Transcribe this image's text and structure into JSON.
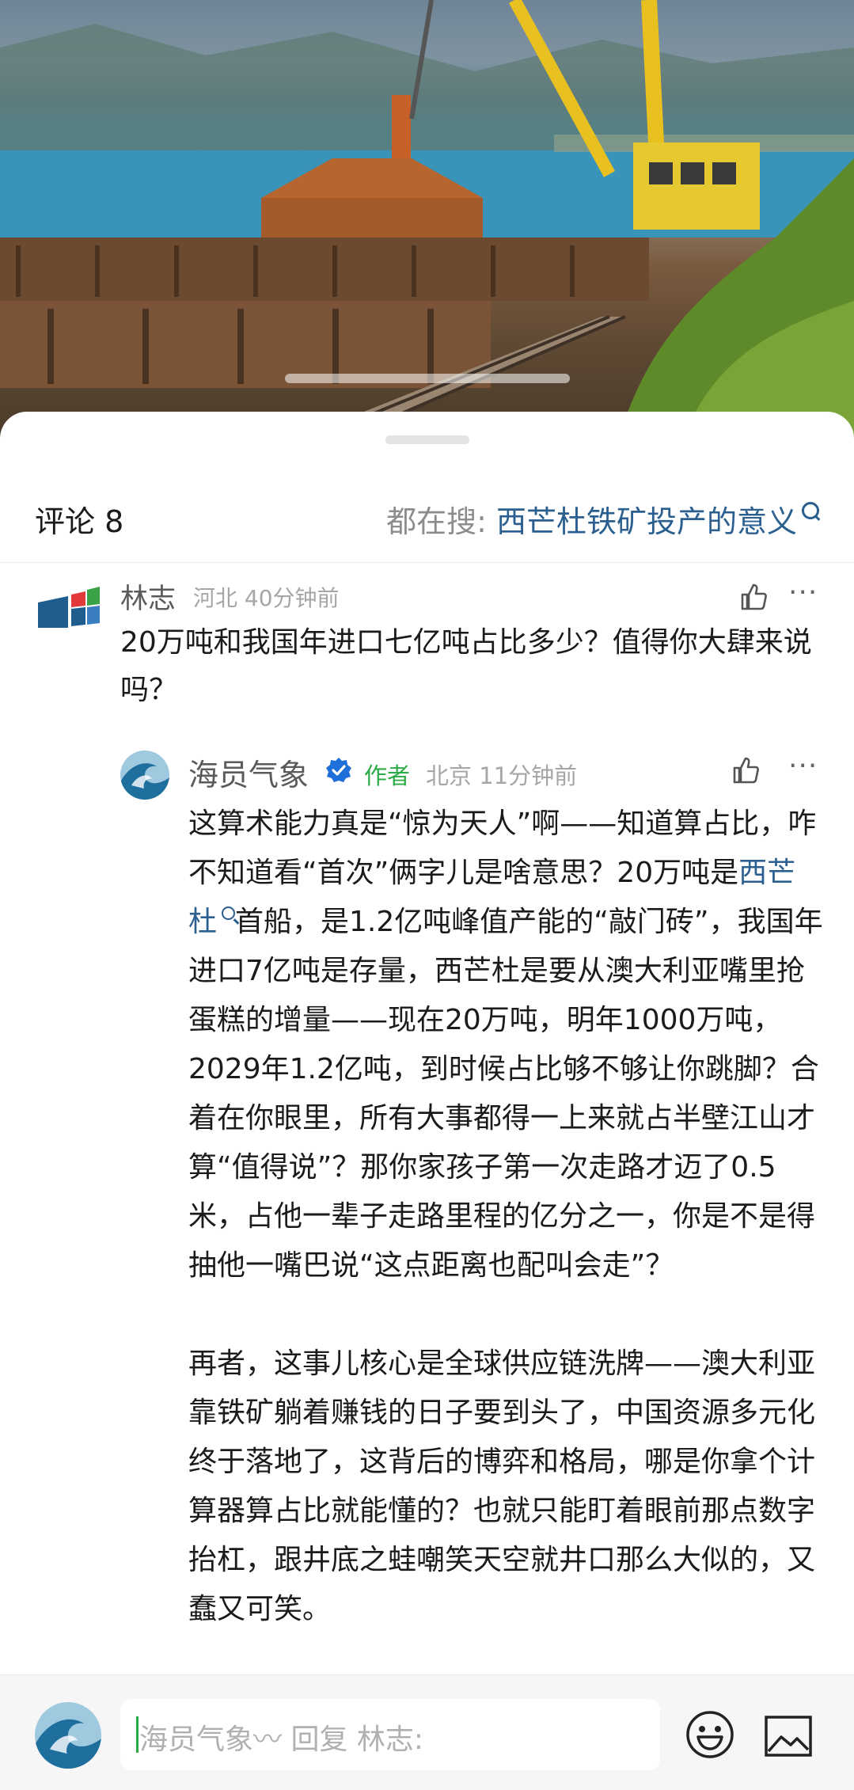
{
  "comments_header": {
    "title": "评论 8",
    "hot_search_label": "都在搜: ",
    "hot_search_link": "西芒杜铁矿投产的意义"
  },
  "comment": {
    "author": "林志",
    "location_time": "河北 40分钟前",
    "text": "20万吨和我国年进口七亿吨占比多少？值得你大肆来说吗？"
  },
  "reply": {
    "author": "海员气象",
    "badge": "作者",
    "location_time": "北京 11分钟前",
    "p1_before": "这算术能力真是“惊为天人”啊——知道算占比，咋不知道看“首次”俩字儿是啥意思？20万吨是",
    "p1_link": "西芒杜",
    "p1_after": "首船，是1.2亿吨峰值产能的“敲门砖”，我国年进口7亿吨是存量，西芒杜是要从澳大利亚嘴里抢蛋糕的增量——现在20万吨，明年1000万吨，2029年1.2亿吨，到时候占比够不够让你跳脚？合着在你眼里，所有大事都得一上来就占半壁江山才算“值得说”？那你家孩子第一次走路才迈了0.5米，占他一辈子走路里程的亿分之一，你是不是得抽他一嘴巴说“这点距离也配叫会走”？",
    "p2": "再者，这事儿核心是全球供应链洗牌——澳大利亚靠铁矿躺着赚钱的日子要到头了，中国资源多元化终于落地了，这背后的博弈和格局，哪是你拿个计算器算占比就能懂的？也就只能盯着眼前那点数字抬杠，跟井底之蛙嘲笑天空就井口那么大似的，又蠢又可笑。"
  },
  "reply_bar": {
    "placeholder": "海员气象〰 回复 林志:"
  },
  "icons": {
    "like": "thumbs-up-icon",
    "more": "more-dots-icon",
    "verified": "verified-check-icon",
    "emoji": "emoji-icon",
    "image": "image-icon"
  },
  "colors": {
    "link": "#2a5f8f",
    "author_badge": "#2aab45",
    "verified": "#1e6fd9"
  }
}
